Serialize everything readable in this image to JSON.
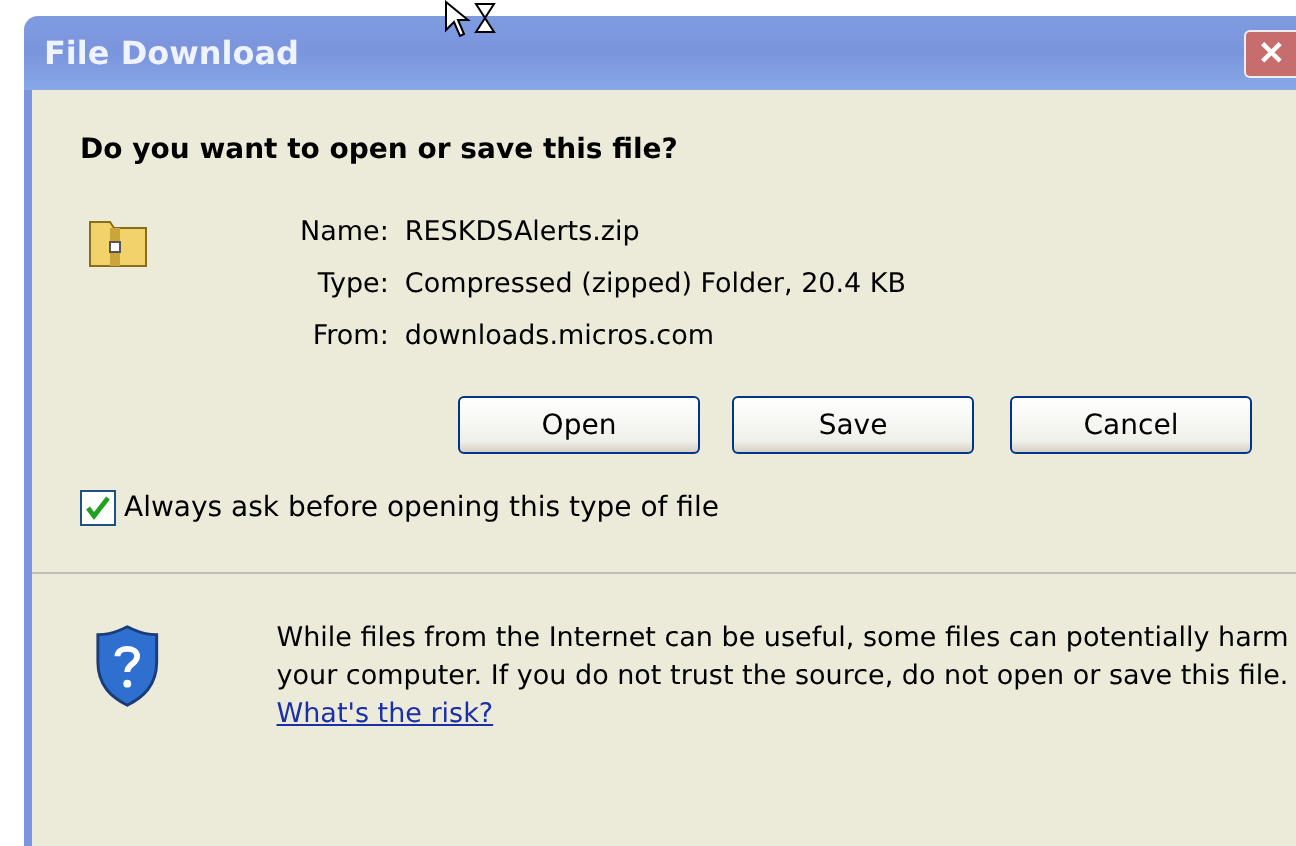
{
  "window": {
    "title": "File Download",
    "close_button": "✕"
  },
  "question": "Do you want to open or save this file?",
  "details": [
    {
      "label": "Name:",
      "value": "RESKDSAlerts.zip"
    },
    {
      "label": "Type:",
      "value": "Compressed (zipped) Folder, 20.4 KB"
    },
    {
      "label": "From:",
      "value": "downloads.micros.com"
    }
  ],
  "buttons": [
    "Open",
    "Save",
    "Cancel"
  ],
  "always_ask": {
    "label": "Always ask before opening this type of file",
    "checked": true
  },
  "warning": {
    "text": "While files from the Internet can be useful, some files can potentially harm your computer. If you do not trust the source, do not open or save this file.",
    "link": "What's the risk?"
  }
}
